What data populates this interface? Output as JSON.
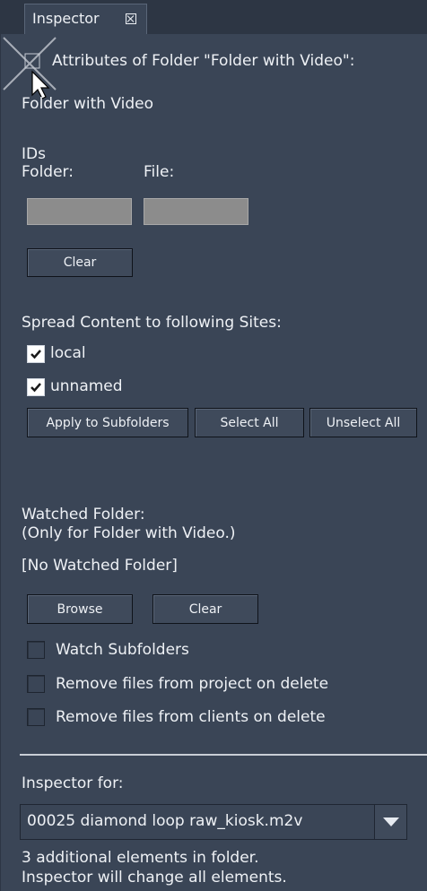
{
  "tab": {
    "title": "Inspector",
    "close_icon": "close-box-icon"
  },
  "header": {
    "attributes_title": "Attributes of Folder \"Folder with Video\":"
  },
  "folder_name": "Folder with Video",
  "ids": {
    "label": "IDs",
    "folder_label": "Folder:",
    "file_label": "File:",
    "folder_value": "",
    "file_value": "",
    "clear_label": "Clear"
  },
  "spread": {
    "label": "Spread Content to following Sites:",
    "sites": [
      {
        "label": "local",
        "checked": true
      },
      {
        "label": "unnamed",
        "checked": true
      }
    ],
    "apply_label": "Apply to Subfolders",
    "select_all_label": "Select All",
    "unselect_all_label": "Unselect All"
  },
  "watched": {
    "label": "Watched Folder:",
    "sublabel": "(Only for Folder with Video.)",
    "value": "[No Watched Folder]",
    "browse_label": "Browse",
    "clear_label": "Clear",
    "options": [
      {
        "label": "Watch Subfolders",
        "checked": false
      },
      {
        "label": "Remove files from project on delete",
        "checked": false
      },
      {
        "label": "Remove files from clients on delete",
        "checked": false
      }
    ]
  },
  "inspector_for": {
    "label": "Inspector for:",
    "selected": "00025 diamond loop raw_kiosk.m2v",
    "info_line1": "3 additional elements in folder.",
    "info_line2": "Inspector will change all elements."
  }
}
